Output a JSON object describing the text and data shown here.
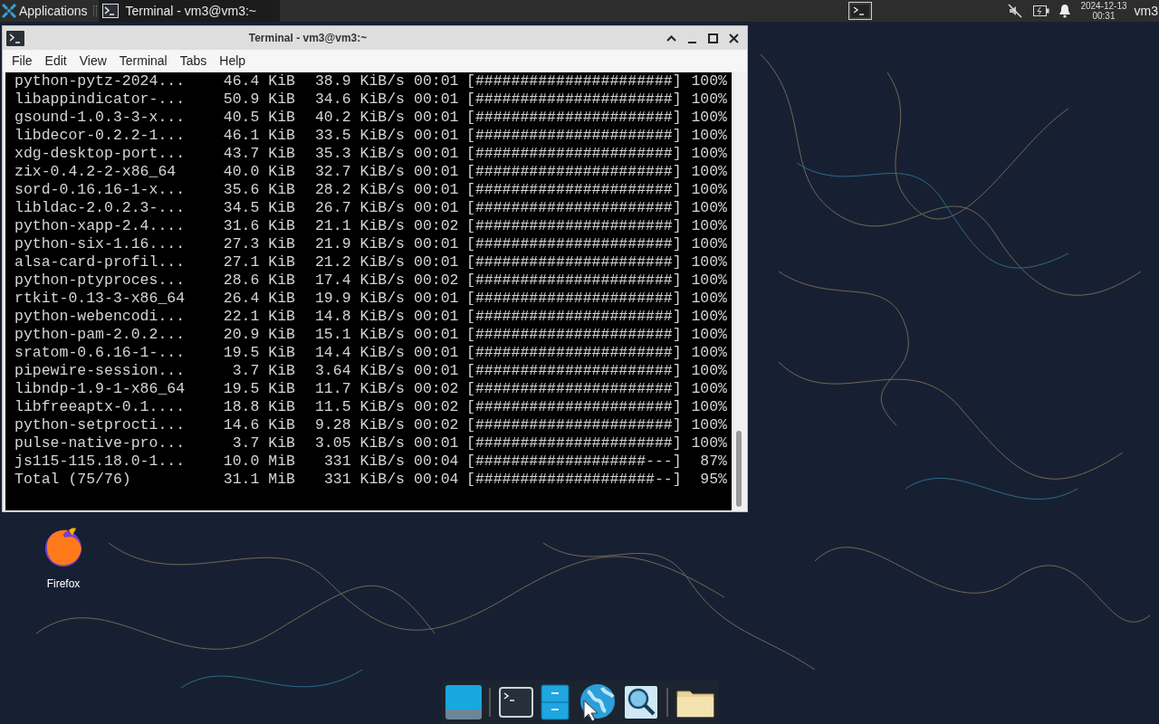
{
  "top_panel": {
    "applications": "Applications",
    "tasks": [
      {
        "title": "Terminal - vm3@vm3:~",
        "selected": true
      }
    ],
    "clock": {
      "date": "2024-12-13",
      "time": "00:31"
    },
    "user": "vm3"
  },
  "window": {
    "title": "Terminal - vm3@vm3:~",
    "menu": [
      "File",
      "Edit",
      "View",
      "Terminal",
      "Tabs",
      "Help"
    ],
    "terminal": {
      "rows": [
        {
          "name": "python-pytz-2024...",
          "size": "46.4 KiB",
          "speed": "38.9 KiB/s",
          "time": "00:01",
          "bar": "[######################]",
          "percent": "100%"
        },
        {
          "name": "libappindicator-...",
          "size": "50.9 KiB",
          "speed": "34.6 KiB/s",
          "time": "00:01",
          "bar": "[######################]",
          "percent": "100%"
        },
        {
          "name": "gsound-1.0.3-3-x...",
          "size": "40.5 KiB",
          "speed": "40.2 KiB/s",
          "time": "00:01",
          "bar": "[######################]",
          "percent": "100%"
        },
        {
          "name": "libdecor-0.2.2-1...",
          "size": "46.1 KiB",
          "speed": "33.5 KiB/s",
          "time": "00:01",
          "bar": "[######################]",
          "percent": "100%"
        },
        {
          "name": "xdg-desktop-port...",
          "size": "43.7 KiB",
          "speed": "35.3 KiB/s",
          "time": "00:01",
          "bar": "[######################]",
          "percent": "100%"
        },
        {
          "name": "zix-0.4.2-2-x86_64",
          "size": "40.0 KiB",
          "speed": "32.7 KiB/s",
          "time": "00:01",
          "bar": "[######################]",
          "percent": "100%"
        },
        {
          "name": "sord-0.16.16-1-x...",
          "size": "35.6 KiB",
          "speed": "28.2 KiB/s",
          "time": "00:01",
          "bar": "[######################]",
          "percent": "100%"
        },
        {
          "name": "libldac-2.0.2.3-...",
          "size": "34.5 KiB",
          "speed": "26.7 KiB/s",
          "time": "00:01",
          "bar": "[######################]",
          "percent": "100%"
        },
        {
          "name": "python-xapp-2.4....",
          "size": "31.6 KiB",
          "speed": "21.1 KiB/s",
          "time": "00:02",
          "bar": "[######################]",
          "percent": "100%"
        },
        {
          "name": "python-six-1.16....",
          "size": "27.3 KiB",
          "speed": "21.9 KiB/s",
          "time": "00:01",
          "bar": "[######################]",
          "percent": "100%"
        },
        {
          "name": "alsa-card-profil...",
          "size": "27.1 KiB",
          "speed": "21.2 KiB/s",
          "time": "00:01",
          "bar": "[######################]",
          "percent": "100%"
        },
        {
          "name": "python-ptyproces...",
          "size": "28.6 KiB",
          "speed": "17.4 KiB/s",
          "time": "00:02",
          "bar": "[######################]",
          "percent": "100%"
        },
        {
          "name": "rtkit-0.13-3-x86_64",
          "size": "26.4 KiB",
          "speed": "19.9 KiB/s",
          "time": "00:01",
          "bar": "[######################]",
          "percent": "100%"
        },
        {
          "name": "python-webencodi...",
          "size": "22.1 KiB",
          "speed": "14.8 KiB/s",
          "time": "00:01",
          "bar": "[######################]",
          "percent": "100%"
        },
        {
          "name": "python-pam-2.0.2...",
          "size": "20.9 KiB",
          "speed": "15.1 KiB/s",
          "time": "00:01",
          "bar": "[######################]",
          "percent": "100%"
        },
        {
          "name": "sratom-0.6.16-1-...",
          "size": "19.5 KiB",
          "speed": "14.4 KiB/s",
          "time": "00:01",
          "bar": "[######################]",
          "percent": "100%"
        },
        {
          "name": "pipewire-session...",
          "size": "3.7 KiB",
          "speed": "3.64 KiB/s",
          "time": "00:01",
          "bar": "[######################]",
          "percent": "100%"
        },
        {
          "name": "libndp-1.9-1-x86_64",
          "size": "19.5 KiB",
          "speed": "11.7 KiB/s",
          "time": "00:02",
          "bar": "[######################]",
          "percent": "100%"
        },
        {
          "name": "libfreeaptx-0.1....",
          "size": "18.8 KiB",
          "speed": "11.5 KiB/s",
          "time": "00:02",
          "bar": "[######################]",
          "percent": "100%"
        },
        {
          "name": "python-setprocti...",
          "size": "14.6 KiB",
          "speed": "9.28 KiB/s",
          "time": "00:02",
          "bar": "[######################]",
          "percent": "100%"
        },
        {
          "name": "pulse-native-pro...",
          "size": "3.7 KiB",
          "speed": "3.05 KiB/s",
          "time": "00:01",
          "bar": "[######################]",
          "percent": "100%"
        },
        {
          "name": "js115-115.18.0-1...",
          "size": "10.0 MiB",
          "speed": "331 KiB/s",
          "time": "00:04",
          "bar": "[###################---]",
          "percent": "87%"
        },
        {
          "name": "Total (75/76)",
          "size": "31.1 MiB",
          "speed": "331 KiB/s",
          "time": "00:04",
          "bar": "[####################--]",
          "percent": "95%"
        }
      ]
    }
  },
  "desktop_icons": [
    {
      "label": "Firefox"
    }
  ]
}
